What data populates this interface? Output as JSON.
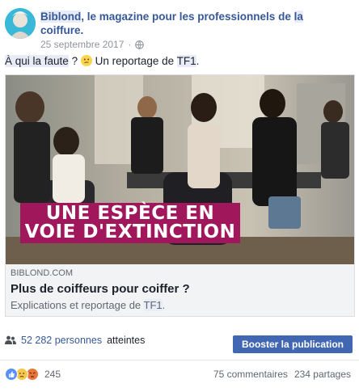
{
  "post": {
    "author_name": "Biblond",
    "author_suffix_pre": ", le magazine pour les professionnels de ",
    "author_suffix_la": "la",
    "author_suffix_line2": "coiffure.",
    "date": "25 septembre 2017",
    "visibility_icon": "globe-icon",
    "caption_part1": "À qui la faute",
    "caption_part2": " ? ",
    "caption_part3": " Un reportage de ",
    "caption_part4": "TF1",
    "caption_part5": ".",
    "caption_emoji": "thinking-face-emoji"
  },
  "link_card": {
    "image_banner_line1": "UNE ESPÈCE EN",
    "image_banner_line2": "VOIE D'EXTINCTION",
    "domain": "BIBLOND.COM",
    "title": "Plus de coiffeurs pour coiffer ?",
    "description_pre": "Explications et reportage de ",
    "description_tf1": "TF1",
    "description_post": "."
  },
  "reach": {
    "icon": "people-icon",
    "count": "52 282 personnes",
    "label": "atteintes"
  },
  "boost_button": {
    "label": "Booster la publication",
    "color": "#4267b2"
  },
  "reactions": {
    "icons": [
      "like-icon",
      "sad-icon",
      "angry-icon"
    ],
    "count": "245",
    "comments": "75 commentaires",
    "shares": "234 partages"
  },
  "colors": {
    "link_blue": "#365899",
    "banner_magenta": "#a1175c",
    "highlight": "#e7ecf7"
  }
}
